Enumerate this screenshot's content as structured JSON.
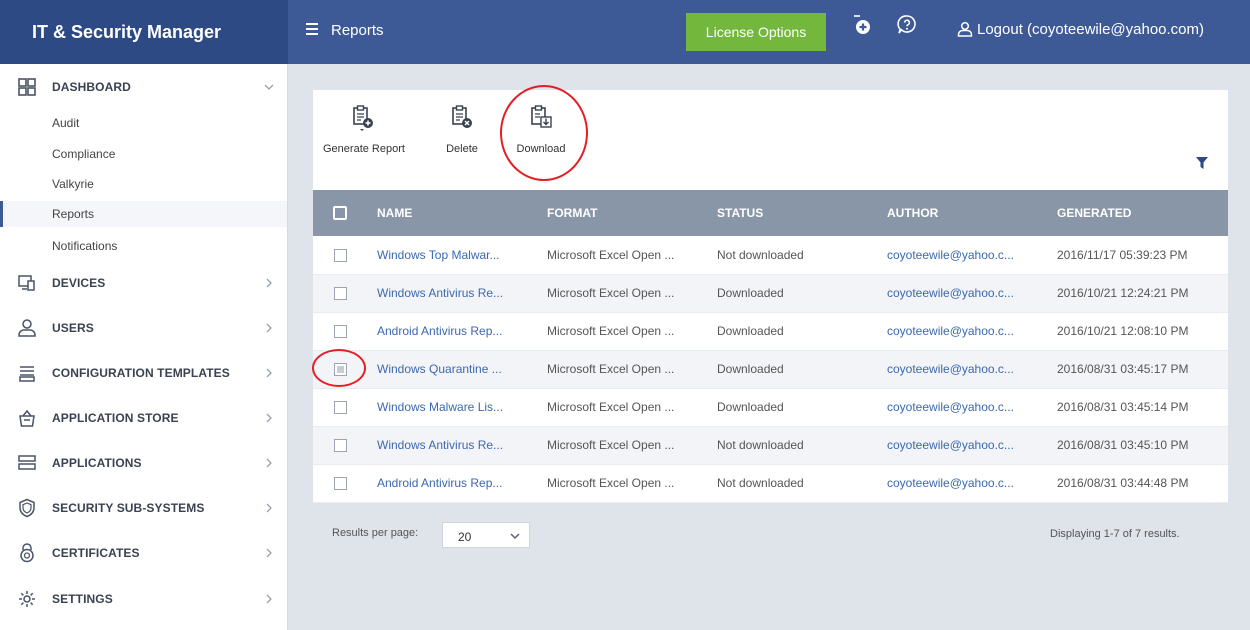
{
  "app": {
    "title": "IT & Security Manager",
    "page": "Reports"
  },
  "header": {
    "license_label": "License Options",
    "logout_label": "Logout (coyoteewile@yahoo.com)",
    "icons": [
      "add-circle-icon",
      "help-icon",
      "user-icon"
    ]
  },
  "sidebar": {
    "dashboard": {
      "label": "DASHBOARD",
      "icon": "dashboard-grid-icon",
      "children": [
        "Audit",
        "Compliance",
        "Valkyrie",
        "Reports",
        "Notifications"
      ],
      "active_child": "Reports"
    },
    "items": [
      {
        "label": "DEVICES",
        "icon": "devices-icon"
      },
      {
        "label": "USERS",
        "icon": "user-icon"
      },
      {
        "label": "CONFIGURATION TEMPLATES",
        "icon": "templates-icon"
      },
      {
        "label": "APPLICATION STORE",
        "icon": "store-icon"
      },
      {
        "label": "APPLICATIONS",
        "icon": "applications-icon"
      },
      {
        "label": "SECURITY SUB-SYSTEMS",
        "icon": "shield-icon"
      },
      {
        "label": "CERTIFICATES",
        "icon": "certificate-icon"
      },
      {
        "label": "SETTINGS",
        "icon": "gear-icon"
      }
    ]
  },
  "toolbar": {
    "generate_label": "Generate Report",
    "delete_label": "Delete",
    "download_label": "Download"
  },
  "table": {
    "columns": [
      "NAME",
      "FORMAT",
      "STATUS",
      "AUTHOR",
      "GENERATED"
    ],
    "rows": [
      {
        "name": "Windows Top Malwar...",
        "format": "Microsoft Excel Open ...",
        "status": "Not downloaded",
        "author": "coyoteewile@yahoo.c...",
        "generated": "2016/11/17 05:39:23 PM",
        "checked": false
      },
      {
        "name": "Windows Antivirus Re...",
        "format": "Microsoft Excel Open ...",
        "status": "Downloaded",
        "author": "coyoteewile@yahoo.c...",
        "generated": "2016/10/21 12:24:21 PM",
        "checked": false
      },
      {
        "name": "Android Antivirus Rep...",
        "format": "Microsoft Excel Open ...",
        "status": "Downloaded",
        "author": "coyoteewile@yahoo.c...",
        "generated": "2016/10/21 12:08:10 PM",
        "checked": false
      },
      {
        "name": "Windows Quarantine ...",
        "format": "Microsoft Excel Open ...",
        "status": "Downloaded",
        "author": "coyoteewile@yahoo.c...",
        "generated": "2016/08/31 03:45:17 PM",
        "checked": true
      },
      {
        "name": "Windows Malware Lis...",
        "format": "Microsoft Excel Open ...",
        "status": "Downloaded",
        "author": "coyoteewile@yahoo.c...",
        "generated": "2016/08/31 03:45:14 PM",
        "checked": false
      },
      {
        "name": "Windows Antivirus Re...",
        "format": "Microsoft Excel Open ...",
        "status": "Not downloaded",
        "author": "coyoteewile@yahoo.c...",
        "generated": "2016/08/31 03:45:10 PM",
        "checked": false
      },
      {
        "name": "Android Antivirus Rep...",
        "format": "Microsoft Excel Open ...",
        "status": "Not downloaded",
        "author": "coyoteewile@yahoo.c...",
        "generated": "2016/08/31 03:44:48 PM",
        "checked": false
      }
    ]
  },
  "footer": {
    "per_page_label": "Results per page:",
    "per_page_value": "20",
    "summary": "Displaying 1-7 of 7 results."
  },
  "colors": {
    "topbar": "#3d5a96",
    "brand": "#2d4a85",
    "license_button": "#73b83c",
    "table_header": "#8996a8",
    "link": "#3b68b0",
    "annotation": "#e31e24"
  }
}
